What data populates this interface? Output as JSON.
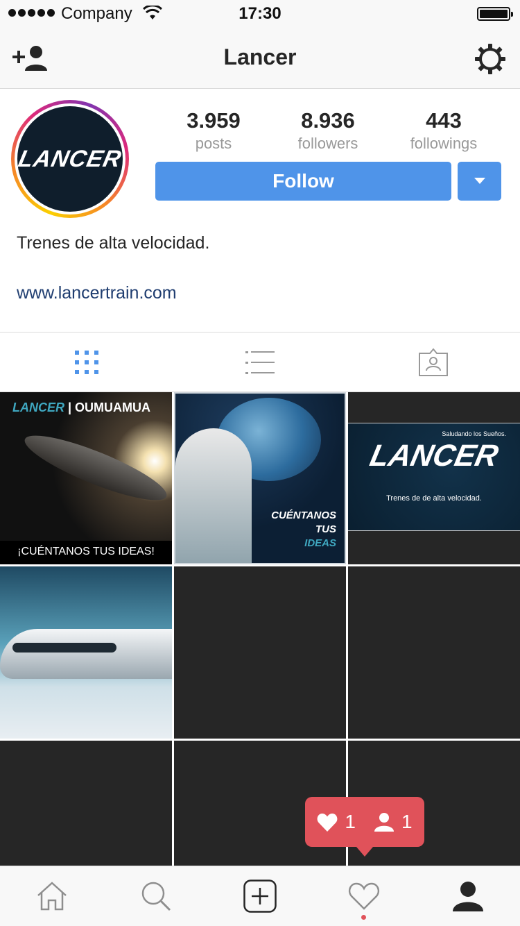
{
  "status_bar": {
    "carrier": "Company",
    "time": "17:30",
    "icons": [
      "signal-dots-icon",
      "wifi-icon",
      "battery-icon"
    ]
  },
  "nav": {
    "title": "Lancer",
    "left_icon": "add-user-icon",
    "right_icon": "gear-icon"
  },
  "profile": {
    "avatar_text": "LANCER",
    "stats": [
      {
        "value": "3.959",
        "label": "posts"
      },
      {
        "value": "8.936",
        "label": "followers"
      },
      {
        "value": "443",
        "label": "followings"
      }
    ],
    "follow_label": "Follow",
    "bio": "Trenes de alta velocidad.",
    "website": "www.lancertrain.com"
  },
  "tabs": [
    {
      "icon": "grid-icon",
      "active": true
    },
    {
      "icon": "list-icon",
      "active": false
    },
    {
      "icon": "tagged-icon",
      "active": false
    }
  ],
  "posts": [
    {
      "brand": "LANCER",
      "title": "OUMUAMUA",
      "caption": "¡CUÉNTANOS TUS IDEAS!"
    },
    {
      "lines": [
        "CUÉNTANOS",
        "TUS",
        "IDEAS"
      ]
    },
    {
      "tagline": "Saludando los Sueños.",
      "logo": "LANCER",
      "subtitle": "Trenes de de alta velocidad."
    },
    {},
    {},
    {},
    {},
    {},
    {}
  ],
  "notification": {
    "likes": "1",
    "follows": "1",
    "color": "#e0525a"
  },
  "bottom_tabs": [
    "home-icon",
    "search-icon",
    "add-post-icon",
    "activity-heart-icon",
    "profile-icon"
  ],
  "colors": {
    "accent": "#4f94e9",
    "link": "#1f3d70",
    "grid_placeholder": "#262626"
  }
}
